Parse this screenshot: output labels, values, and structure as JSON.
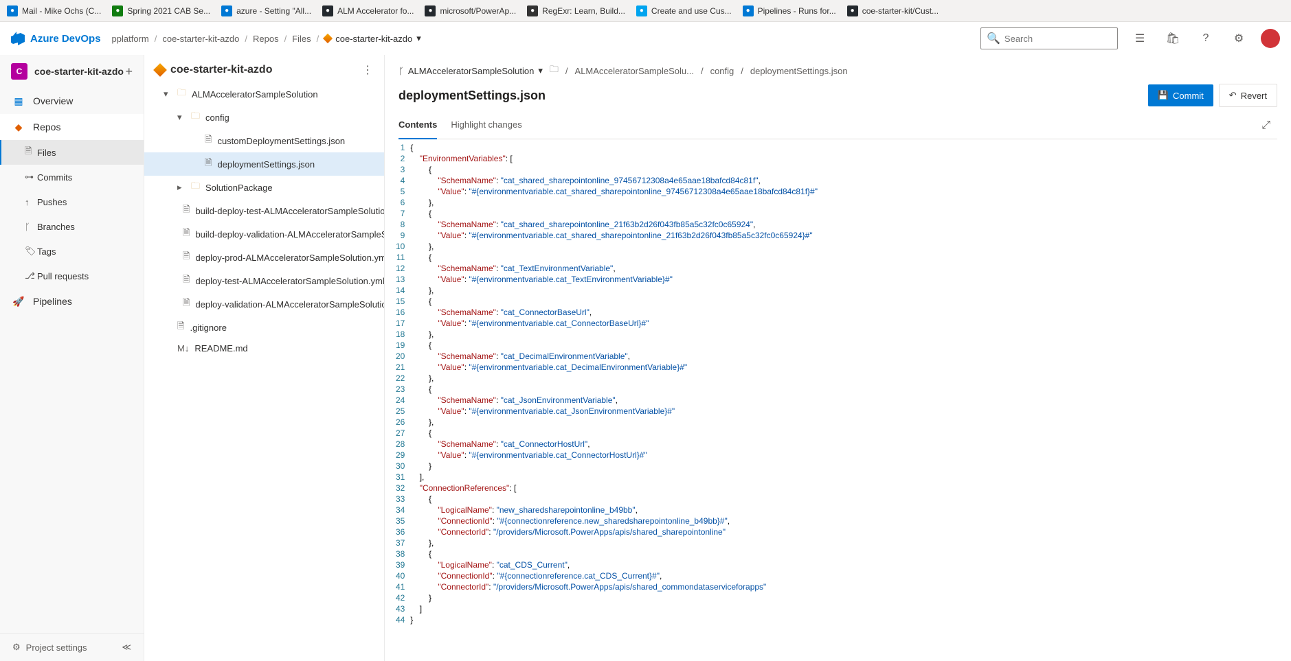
{
  "browser_tabs": [
    {
      "label": "Mail - Mike Ochs (C...",
      "color": "#0078d4"
    },
    {
      "label": "Spring 2021 CAB Se...",
      "color": "#107c10"
    },
    {
      "label": "azure - Setting \"All...",
      "color": "#0078d4"
    },
    {
      "label": "ALM Accelerator fo...",
      "color": "#24292e"
    },
    {
      "label": "microsoft/PowerAp...",
      "color": "#24292e"
    },
    {
      "label": "RegExr: Learn, Build...",
      "color": "#333"
    },
    {
      "label": "Create and use Cus...",
      "color": "#00a4ef"
    },
    {
      "label": "Pipelines - Runs for...",
      "color": "#0078d4"
    },
    {
      "label": "coe-starter-kit/Cust...",
      "color": "#24292e"
    }
  ],
  "brand": "Azure DevOps",
  "breadcrumb": [
    "pplatform",
    "coe-starter-kit-azdo",
    "Repos",
    "Files"
  ],
  "breadcrumb_current": "coe-starter-kit-azdo",
  "search_placeholder": "Search",
  "project_name": "coe-starter-kit-azdo",
  "project_initial": "C",
  "nav": [
    {
      "label": "Overview"
    },
    {
      "label": "Repos",
      "active": true
    }
  ],
  "nav_subs": [
    {
      "label": "Files",
      "active": true
    },
    {
      "label": "Commits"
    },
    {
      "label": "Pushes"
    },
    {
      "label": "Branches"
    },
    {
      "label": "Tags"
    },
    {
      "label": "Pull requests"
    }
  ],
  "nav_pipelines": "Pipelines",
  "nav_footer": "Project settings",
  "repo_name": "coe-starter-kit-azdo",
  "tree": [
    {
      "d": 0,
      "t": "folder",
      "chev": "▾",
      "label": "ALMAcceleratorSampleSolution"
    },
    {
      "d": 1,
      "t": "folder",
      "chev": "▾",
      "label": "config"
    },
    {
      "d": 2,
      "t": "file",
      "label": "customDeploymentSettings.json"
    },
    {
      "d": 2,
      "t": "file",
      "label": "deploymentSettings.json",
      "sel": true
    },
    {
      "d": 1,
      "t": "folder",
      "chev": "▸",
      "label": "SolutionPackage"
    },
    {
      "d": 1,
      "t": "file",
      "label": "build-deploy-test-ALMAcceleratorSampleSolutio..."
    },
    {
      "d": 1,
      "t": "file",
      "label": "build-deploy-validation-ALMAcceleratorSampleS..."
    },
    {
      "d": 1,
      "t": "file",
      "label": "deploy-prod-ALMAcceleratorSampleSolution.yml"
    },
    {
      "d": 1,
      "t": "file",
      "label": "deploy-test-ALMAcceleratorSampleSolution.yml"
    },
    {
      "d": 1,
      "t": "file",
      "label": "deploy-validation-ALMAcceleratorSampleSolutio..."
    },
    {
      "d": 0,
      "t": "file",
      "label": ".gitignore"
    },
    {
      "d": 0,
      "t": "md",
      "label": "README.md"
    }
  ],
  "branch_name": "ALMAcceleratorSampleSolution",
  "path": [
    "ALMAcceleratorSampleSolu...",
    "config",
    "deploymentSettings.json"
  ],
  "file_title": "deploymentSettings.json",
  "commit_label": "Commit",
  "revert_label": "Revert",
  "tab_contents": "Contents",
  "tab_highlight": "Highlight changes",
  "code_lines": [
    [
      [
        "p",
        "{"
      ]
    ],
    [
      [
        "p",
        "    "
      ],
      [
        "k",
        "\"EnvironmentVariables\""
      ],
      [
        "p",
        ": ["
      ]
    ],
    [
      [
        "p",
        "        {"
      ]
    ],
    [
      [
        "p",
        "            "
      ],
      [
        "k",
        "\"SchemaName\""
      ],
      [
        "p",
        ": "
      ],
      [
        "s",
        "\"cat_shared_sharepointonline_97456712308a4e65aae18bafcd84c81f\""
      ],
      [
        "p",
        ","
      ]
    ],
    [
      [
        "p",
        "            "
      ],
      [
        "k",
        "\"Value\""
      ],
      [
        "p",
        ": "
      ],
      [
        "s",
        "\"#{environmentvariable.cat_shared_sharepointonline_97456712308a4e65aae18bafcd84c81f}#\""
      ]
    ],
    [
      [
        "p",
        "        },"
      ]
    ],
    [
      [
        "p",
        "        {"
      ]
    ],
    [
      [
        "p",
        "            "
      ],
      [
        "k",
        "\"SchemaName\""
      ],
      [
        "p",
        ": "
      ],
      [
        "s",
        "\"cat_shared_sharepointonline_21f63b2d26f043fb85a5c32fc0c65924\""
      ],
      [
        "p",
        ","
      ]
    ],
    [
      [
        "p",
        "            "
      ],
      [
        "k",
        "\"Value\""
      ],
      [
        "p",
        ": "
      ],
      [
        "s",
        "\"#{environmentvariable.cat_shared_sharepointonline_21f63b2d26f043fb85a5c32fc0c65924}#\""
      ]
    ],
    [
      [
        "p",
        "        },"
      ]
    ],
    [
      [
        "p",
        "        {"
      ]
    ],
    [
      [
        "p",
        "            "
      ],
      [
        "k",
        "\"SchemaName\""
      ],
      [
        "p",
        ": "
      ],
      [
        "s",
        "\"cat_TextEnvironmentVariable\""
      ],
      [
        "p",
        ","
      ]
    ],
    [
      [
        "p",
        "            "
      ],
      [
        "k",
        "\"Value\""
      ],
      [
        "p",
        ": "
      ],
      [
        "s",
        "\"#{environmentvariable.cat_TextEnvironmentVariable}#\""
      ]
    ],
    [
      [
        "p",
        "        },"
      ]
    ],
    [
      [
        "p",
        "        {"
      ]
    ],
    [
      [
        "p",
        "            "
      ],
      [
        "k",
        "\"SchemaName\""
      ],
      [
        "p",
        ": "
      ],
      [
        "s",
        "\"cat_ConnectorBaseUrl\""
      ],
      [
        "p",
        ","
      ]
    ],
    [
      [
        "p",
        "            "
      ],
      [
        "k",
        "\"Value\""
      ],
      [
        "p",
        ": "
      ],
      [
        "s",
        "\"#{environmentvariable.cat_ConnectorBaseUrl}#\""
      ]
    ],
    [
      [
        "p",
        "        },"
      ]
    ],
    [
      [
        "p",
        "        {"
      ]
    ],
    [
      [
        "p",
        "            "
      ],
      [
        "k",
        "\"SchemaName\""
      ],
      [
        "p",
        ": "
      ],
      [
        "s",
        "\"cat_DecimalEnvironmentVariable\""
      ],
      [
        "p",
        ","
      ]
    ],
    [
      [
        "p",
        "            "
      ],
      [
        "k",
        "\"Value\""
      ],
      [
        "p",
        ": "
      ],
      [
        "s",
        "\"#{environmentvariable.cat_DecimalEnvironmentVariable}#\""
      ]
    ],
    [
      [
        "p",
        "        },"
      ]
    ],
    [
      [
        "p",
        "        {"
      ]
    ],
    [
      [
        "p",
        "            "
      ],
      [
        "k",
        "\"SchemaName\""
      ],
      [
        "p",
        ": "
      ],
      [
        "s",
        "\"cat_JsonEnvironmentVariable\""
      ],
      [
        "p",
        ","
      ]
    ],
    [
      [
        "p",
        "            "
      ],
      [
        "k",
        "\"Value\""
      ],
      [
        "p",
        ": "
      ],
      [
        "s",
        "\"#{environmentvariable.cat_JsonEnvironmentVariable}#\""
      ]
    ],
    [
      [
        "p",
        "        },"
      ]
    ],
    [
      [
        "p",
        "        {"
      ]
    ],
    [
      [
        "p",
        "            "
      ],
      [
        "k",
        "\"SchemaName\""
      ],
      [
        "p",
        ": "
      ],
      [
        "s",
        "\"cat_ConnectorHostUrl\""
      ],
      [
        "p",
        ","
      ]
    ],
    [
      [
        "p",
        "            "
      ],
      [
        "k",
        "\"Value\""
      ],
      [
        "p",
        ": "
      ],
      [
        "s",
        "\"#{environmentvariable.cat_ConnectorHostUrl}#\""
      ]
    ],
    [
      [
        "p",
        "        }"
      ]
    ],
    [
      [
        "p",
        "    ],"
      ]
    ],
    [
      [
        "p",
        "    "
      ],
      [
        "k",
        "\"ConnectionReferences\""
      ],
      [
        "p",
        ": ["
      ]
    ],
    [
      [
        "p",
        "        {"
      ]
    ],
    [
      [
        "p",
        "            "
      ],
      [
        "k",
        "\"LogicalName\""
      ],
      [
        "p",
        ": "
      ],
      [
        "s",
        "\"new_sharedsharepointonline_b49bb\""
      ],
      [
        "p",
        ","
      ]
    ],
    [
      [
        "p",
        "            "
      ],
      [
        "k",
        "\"ConnectionId\""
      ],
      [
        "p",
        ": "
      ],
      [
        "s",
        "\"#{connectionreference.new_sharedsharepointonline_b49bb}#\""
      ],
      [
        "p",
        ","
      ]
    ],
    [
      [
        "p",
        "            "
      ],
      [
        "k",
        "\"ConnectorId\""
      ],
      [
        "p",
        ": "
      ],
      [
        "s",
        "\"/providers/Microsoft.PowerApps/apis/shared_sharepointonline\""
      ]
    ],
    [
      [
        "p",
        "        },"
      ]
    ],
    [
      [
        "p",
        "        {"
      ]
    ],
    [
      [
        "p",
        "            "
      ],
      [
        "k",
        "\"LogicalName\""
      ],
      [
        "p",
        ": "
      ],
      [
        "s",
        "\"cat_CDS_Current\""
      ],
      [
        "p",
        ","
      ]
    ],
    [
      [
        "p",
        "            "
      ],
      [
        "k",
        "\"ConnectionId\""
      ],
      [
        "p",
        ": "
      ],
      [
        "s",
        "\"#{connectionreference.cat_CDS_Current}#\""
      ],
      [
        "p",
        ","
      ]
    ],
    [
      [
        "p",
        "            "
      ],
      [
        "k",
        "\"ConnectorId\""
      ],
      [
        "p",
        ": "
      ],
      [
        "s",
        "\"/providers/Microsoft.PowerApps/apis/shared_commondataserviceforapps\""
      ]
    ],
    [
      [
        "p",
        "        }"
      ]
    ],
    [
      [
        "p",
        "    ]"
      ]
    ],
    [
      [
        "p",
        "}"
      ]
    ]
  ]
}
